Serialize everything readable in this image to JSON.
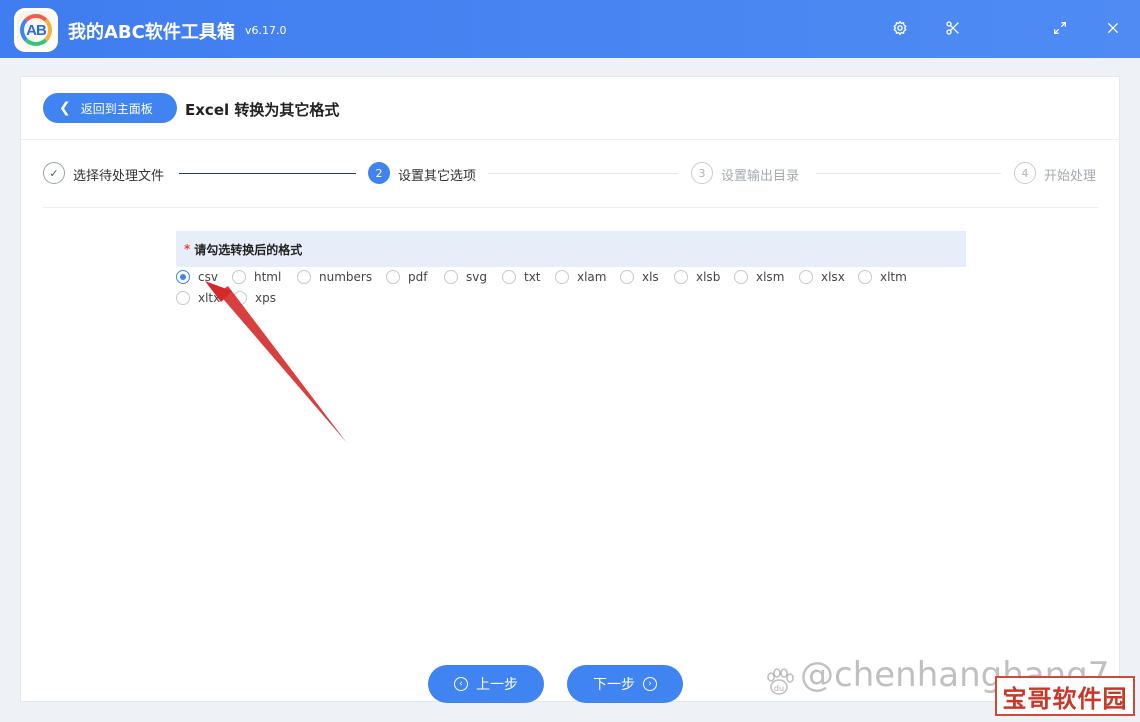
{
  "titlebar": {
    "logo_text": "AB",
    "title": "我的ABC软件工具箱",
    "version": "v6.17.0",
    "icons": [
      "gear-icon",
      "scissors-icon",
      "maximize-icon",
      "close-icon"
    ]
  },
  "header": {
    "back_label": "返回到主面板",
    "page_title": "Excel 转换为其它格式"
  },
  "steps": [
    {
      "num": "✓",
      "label": "选择待处理文件",
      "state": "done"
    },
    {
      "num": "2",
      "label": "设置其它选项",
      "state": "active"
    },
    {
      "num": "3",
      "label": "设置输出目录",
      "state": "idle"
    },
    {
      "num": "4",
      "label": "开始处理",
      "state": "idle"
    }
  ],
  "format": {
    "required_mark": "*",
    "heading": "请勾选转换后的格式",
    "options": [
      "csv",
      "html",
      "numbers",
      "pdf",
      "svg",
      "txt",
      "xlam",
      "xls",
      "xlsb",
      "xlsm",
      "xlsx",
      "xltm",
      "xltx",
      "xps"
    ],
    "selected": "csv"
  },
  "footer": {
    "prev_label": "上一步",
    "next_label": "下一步"
  },
  "watermark": {
    "text": "@chenhanghang7",
    "badge": "宝哥软件园",
    "paw_label": "du"
  },
  "colors": {
    "accent": "#3f84f0",
    "titlebar": "#4a86f2",
    "required": "#e0473b",
    "arrow": "#d42a2a"
  }
}
